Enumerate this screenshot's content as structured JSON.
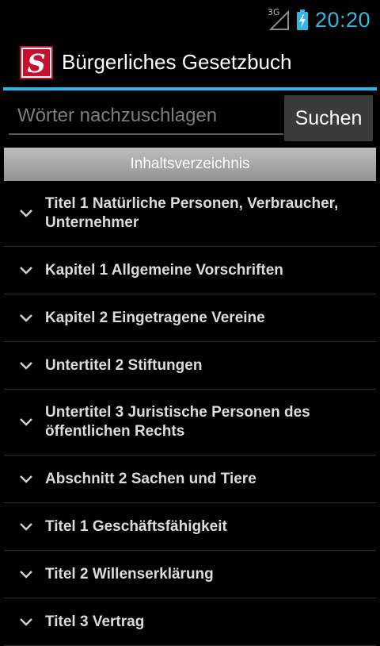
{
  "status_bar": {
    "network": "3G",
    "time": "20:20"
  },
  "app": {
    "title": "Bürgerliches Gesetzbuch",
    "logo_letter": "S",
    "brand_color": "#c8102e",
    "accent_color": "#33b5e5"
  },
  "search": {
    "placeholder": "Wörter nachzuschlagen",
    "value": "",
    "button_label": "Suchen"
  },
  "toc": {
    "header": "Inhaltsverzeichnis",
    "items": [
      {
        "label": "Titel 1 Natürliche Personen, Verbraucher, Unternehmer"
      },
      {
        "label": "Kapitel 1 Allgemeine Vorschriften"
      },
      {
        "label": "Kapitel 2 Eingetragene Vereine"
      },
      {
        "label": "Untertitel 2 Stiftungen"
      },
      {
        "label": "Untertitel 3 Juristische Personen des öffentlichen Rechts"
      },
      {
        "label": "Abschnitt 2 Sachen und Tiere"
      },
      {
        "label": "Titel 1 Geschäftsfähigkeit"
      },
      {
        "label": "Titel 2 Willenserklärung"
      },
      {
        "label": "Titel 3 Vertrag"
      }
    ]
  }
}
